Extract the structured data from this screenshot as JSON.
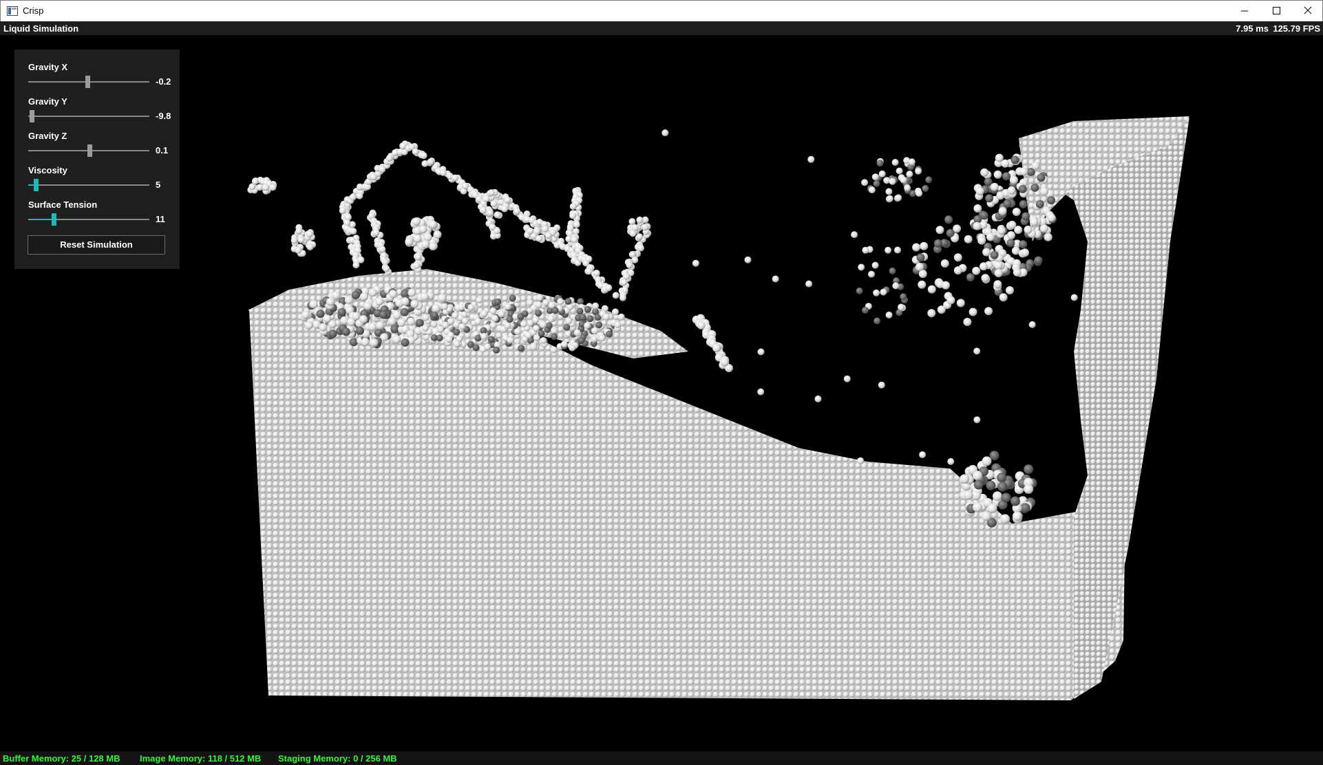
{
  "window": {
    "title": "Crisp",
    "controls": [
      "minimize",
      "maximize",
      "close"
    ]
  },
  "topbar": {
    "title": "Liquid Simulation",
    "frame_time": "7.95 ms",
    "fps": "125.79 FPS"
  },
  "panel": {
    "sliders": [
      {
        "label": "Gravity X",
        "value": "-0.2",
        "fraction": 0.49,
        "accent": false
      },
      {
        "label": "Gravity Y",
        "value": "-9.8",
        "fraction": 0.01,
        "accent": false
      },
      {
        "label": "Gravity Z",
        "value": "0.1",
        "fraction": 0.51,
        "accent": false
      },
      {
        "label": "Viscosity",
        "value": "5",
        "fraction": 0.05,
        "accent": true
      },
      {
        "label": "Surface Tension",
        "value": "11",
        "fraction": 0.2,
        "accent": true
      }
    ],
    "reset_label": "Reset Simulation"
  },
  "status": {
    "buffer": "Buffer Memory: 25 / 128 MB",
    "image": "Image Memory: 118 / 512 MB",
    "staging": "Staging Memory: 0 / 256 MB"
  },
  "colors": {
    "accent": "#1fb7b7",
    "status_text": "#3cf03c",
    "particle": "#e9e9e9",
    "background": "#000000"
  },
  "icons": [
    "app-icon",
    "minimize-icon",
    "maximize-icon",
    "close-icon"
  ]
}
